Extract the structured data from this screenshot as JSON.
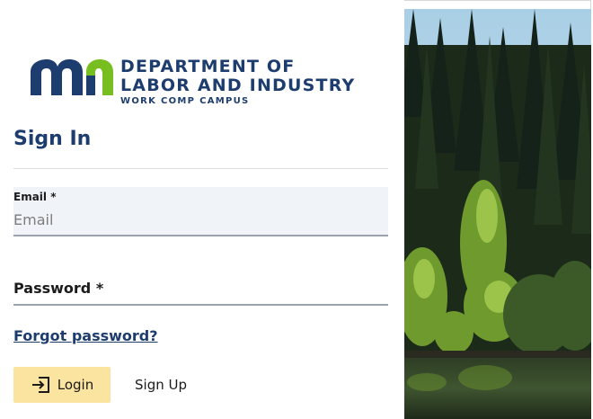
{
  "logo": {
    "line1": "DEPARTMENT OF",
    "line2": "LABOR AND INDUSTRY",
    "subtitle": "WORK COMP CAMPUS",
    "mark_color": "#1d3d6e",
    "accent_color": "#78be20"
  },
  "form": {
    "title": "Sign In",
    "email_label": "Email *",
    "email_placeholder": "Email",
    "email_value": "",
    "password_label": "Password *",
    "forgot_link": "Forgot password?",
    "login_label": "Login",
    "signup_label": "Sign Up"
  },
  "icons": {
    "login": "login-arrow-icon"
  },
  "colors": {
    "primary": "#1d3d6e",
    "login_button": "#fbe3a0"
  }
}
